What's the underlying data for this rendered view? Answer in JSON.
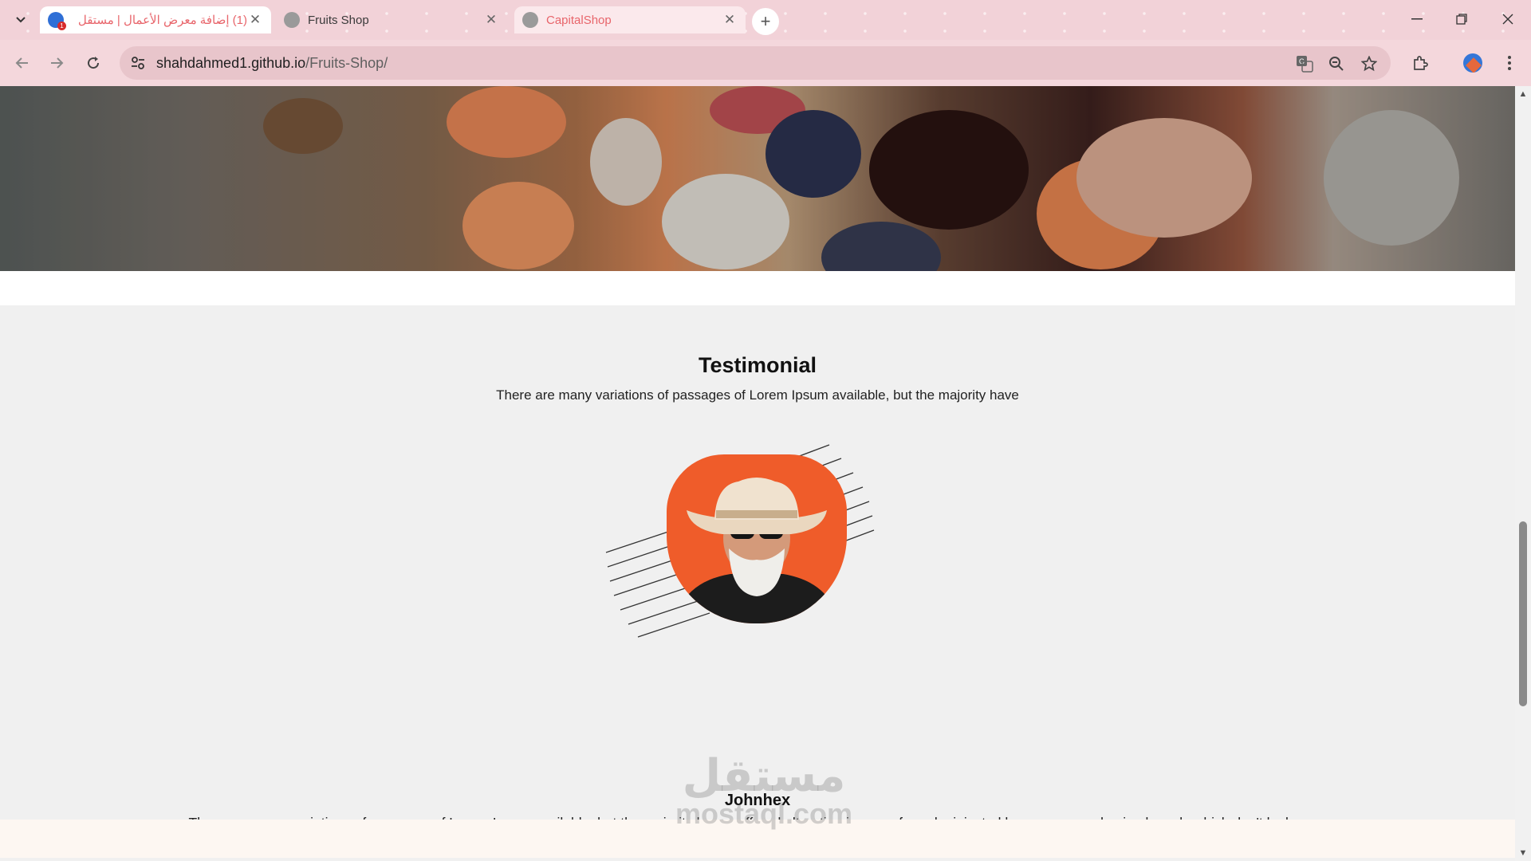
{
  "browser": {
    "tabs": [
      {
        "title": "(1) إضافة معرض الأعمال | مستقل",
        "badge": "1",
        "active": true
      },
      {
        "title": "Fruits Shop",
        "active": false
      },
      {
        "title": "CapitalShop",
        "active": false
      }
    ],
    "new_tab_symbol": "+",
    "close_symbol": "✕",
    "url_host": "shahdahmed1.github.io",
    "url_path": "/Fruits-Shop/",
    "icons": [
      "tab-search-icon",
      "back-icon",
      "forward-icon",
      "reload-icon",
      "site-settings-icon",
      "translate-icon",
      "zoom-icon",
      "bookmark-star-icon",
      "extensions-icon",
      "profile-avatar",
      "menu-kebab-icon",
      "minimize-icon",
      "restore-icon",
      "close-window-icon"
    ]
  },
  "testimonial": {
    "heading": "Testimonial",
    "subheading": "There are many variations of passages of Lorem Ipsum available, but the majority have",
    "name": "Johnhex",
    "text": "There are many variations of passages of Lorem Ipsum available, but the majority have suffered alteration in some form, by injected humour, or randomised words which don't look even slightly believable. If you are going to use a passage of Lorem Ipsum, you need to be sure"
  },
  "watermark": {
    "arabic": "مستقل",
    "latin": "mostaql.com"
  },
  "colors": {
    "accent_orange": "#ef5c2a",
    "chrome_pink": "#f2d2d8",
    "section_bg": "#f0f0f0"
  }
}
